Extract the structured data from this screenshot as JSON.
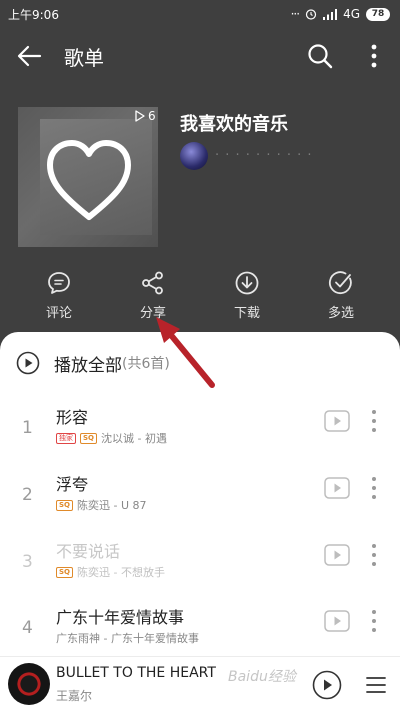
{
  "status_bar": {
    "time": "上午9:06",
    "dots": "···",
    "network": "4G",
    "battery": "78"
  },
  "header": {
    "title": "歌单"
  },
  "playlist": {
    "name": "我喜欢的音乐",
    "play_count": "6",
    "owner_name": "· · · · · · · · · ·"
  },
  "actions": [
    {
      "label": "评论",
      "icon": "comment-icon"
    },
    {
      "label": "分享",
      "icon": "share-icon"
    },
    {
      "label": "下载",
      "icon": "download-icon"
    },
    {
      "label": "多选",
      "icon": "multi-select-icon"
    }
  ],
  "play_all": {
    "label": "播放全部",
    "count": "(共6首)"
  },
  "songs": [
    {
      "index": "1",
      "title": "形容",
      "tags": [
        "独家",
        "SQ"
      ],
      "subtitle": "沈以诚 - 初遇"
    },
    {
      "index": "2",
      "title": "浮夸",
      "tags": [
        "SQ"
      ],
      "subtitle": "陈奕迅 - U 87"
    },
    {
      "index": "3",
      "title": "不要说话",
      "tags": [
        "SQ"
      ],
      "subtitle": "陈奕迅 - 不想放手"
    },
    {
      "index": "4",
      "title": "广东十年爱情故事",
      "tags": [],
      "subtitle": "广东雨神 - 广东十年爱情故事"
    }
  ],
  "now_playing": {
    "title": "BULLET TO THE HEART",
    "artist": "王嘉尔"
  },
  "watermark": "Baidu经验",
  "colors": {
    "background": "#3f3f3f",
    "sheet": "#ffffff",
    "annotation_arrow": "#b8232a",
    "tag_exclusive": "#e04545",
    "tag_sq": "#e08a2a"
  }
}
